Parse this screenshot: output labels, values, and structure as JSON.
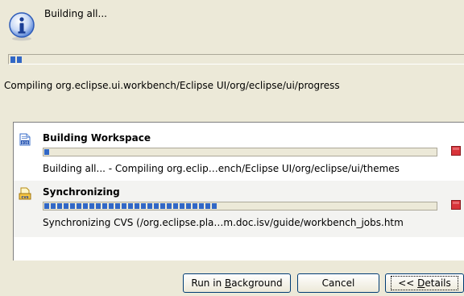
{
  "header": {
    "title": "Building all...",
    "icon": "info-icon"
  },
  "main_progress": {
    "fraction": 0.03
  },
  "main_subtask": "Compiling org.eclipse.ui.workbench/Eclipse UI/org/eclipse/ui/progress",
  "jobs": [
    {
      "title": "Building Workspace",
      "icon": "binary-file-icon",
      "progress": 0.01,
      "status": "Building all... - Compiling org.eclip…ench/Eclipse UI/org/eclipse/ui/themes"
    },
    {
      "title": "Synchronizing",
      "icon": "cvs-icon",
      "progress": 0.45,
      "status": "Synchronizing CVS (/org.eclipse.pla…m.doc.isv/guide/workbench_jobs.htm"
    }
  ],
  "buttons": {
    "run_background_pre": "Run in ",
    "run_background_mnemonic": "B",
    "run_background_post": "ackground",
    "cancel": "Cancel",
    "details_pre": "<< ",
    "details_mnemonic": "D",
    "details_post": "etails"
  },
  "colors": {
    "progress_fill": "#3167c6",
    "stop_red": "#d8333a",
    "dialog_bg": "#ece9d8"
  }
}
